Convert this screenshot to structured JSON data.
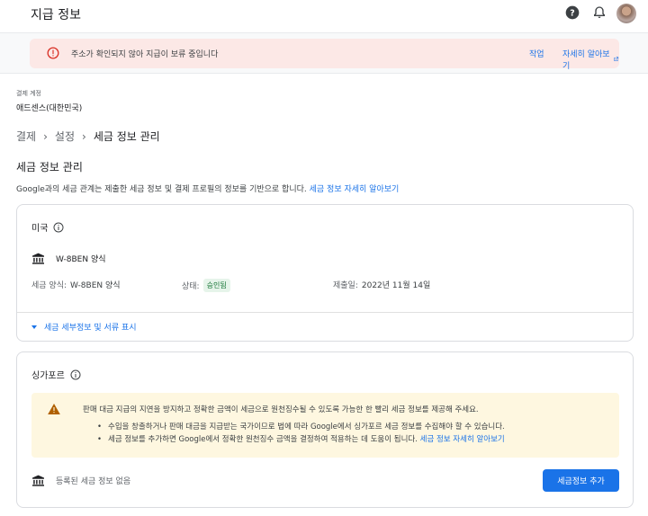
{
  "header": {
    "title": "지급 정보",
    "icons": [
      "help-icon",
      "notifications-icon",
      "avatar"
    ]
  },
  "banner": {
    "message": "주소가 확인되지 않아 지급이 보류 중입니다",
    "action_label": "작업",
    "learn_more_label": "자세히 알아보기",
    "colors": {
      "background": "#fce8e6",
      "icon": "#d93025",
      "link": "#1a73e8"
    }
  },
  "account": {
    "label": "결제 계정",
    "value": "애드센스(대한민국)"
  },
  "breadcrumb": {
    "items": [
      "결제",
      "설정",
      "세금 정보 관리"
    ]
  },
  "page": {
    "title": "세금 정보 관리",
    "description": "Google과의 세금 관계는 제출한 세금 정보 및 결제 프로필의 정보를 기반으로 합니다.",
    "description_link": "세금 정보 자세히 알아보기"
  },
  "us_card": {
    "country": "미국",
    "form_name": "W-8BEN 양식",
    "fields": {
      "form_label": "세금 양식:",
      "form_value": "W-8BEN 양식",
      "status_label": "상태:",
      "status_value": "승인됨",
      "submitted_label": "제출일:",
      "submitted_value": "2022년 11월 14일"
    },
    "expand_label": "세금 세부정보 및 서류 표시"
  },
  "sg_card": {
    "country": "싱가포르",
    "notice": {
      "main": "판매 대금 지급의 지연을 방지하고 정확한 금액이 세금으로 원천징수될 수 있도록 가능한 한 빨리 세금 정보를 제공해 주세요.",
      "bullet1": "수입을 창출하거나 판매 대금을 지급받는 국가이므로 법에 따라 Google에서 싱가포르 세금 정보를 수집해야 할 수 있습니다.",
      "bullet2": "세금 정보를 추가하면 Google에서 정확한 원천징수 금액을 결정하여 적용하는 데 도움이 됩니다.",
      "bullet2_link": "세금 정보 자세히 알아보기"
    },
    "empty_label": "등록된 세금 정보 없음",
    "add_button": "세금정보 추가"
  }
}
